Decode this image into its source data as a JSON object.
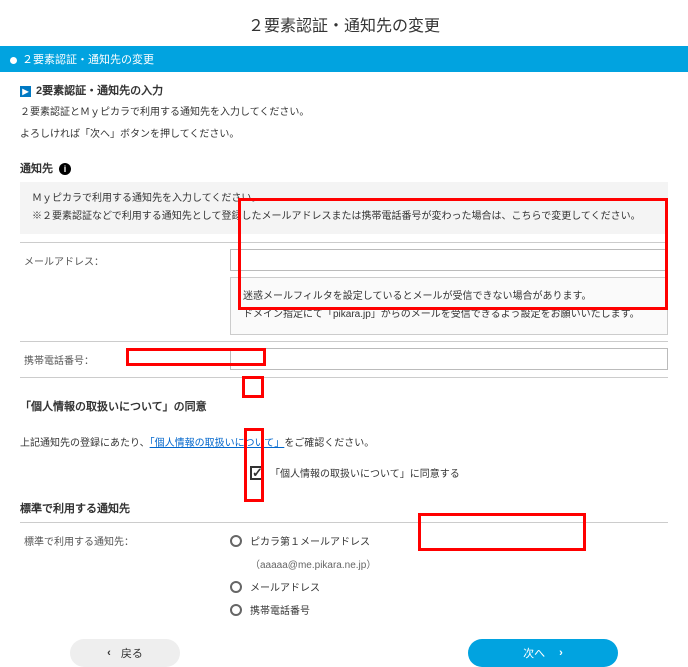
{
  "title": "２要素認証・通知先の変更",
  "blueBar": "２要素認証・通知先の変更",
  "sectionHdr": "2要素認証・通知先の入力",
  "intro1": "２要素認証とＭｙピカラで利用する通知先を入力してください。",
  "intro2": "よろしければ「次へ」ボタンを押してください。",
  "dest": {
    "label": "通知先",
    "box1": "Ｍｙピカラで利用する通知先を入力してください。",
    "box2": "※２要素認証などで利用する通知先として登録したメールアドレスまたは携帯電話番号が変わった場合は、こちらで変更してください。"
  },
  "mail": {
    "label": "メールアドレス：",
    "value": "",
    "note1": "迷惑メールフィルタを設定しているとメールが受信できない場合があります。",
    "note2": "ドメイン指定にて「pikara.jp」からのメールを受信できるよう設定をお願いいたします。"
  },
  "phone": {
    "label": "携帯電話番号：",
    "value": ""
  },
  "privacy": {
    "header": "「個人情報の取扱いについて」の同意",
    "lineBefore": "上記通知先の登録にあたり、",
    "link": "「個人情報の取扱いについて」",
    "lineAfter": "をご確認ください。",
    "consent": "「個人情報の取扱いについて」に同意する",
    "checked": true
  },
  "default": {
    "header": "標準で利用する通知先",
    "label": "標準で利用する通知先：",
    "options": [
      {
        "label": "ピカラ第１メールアドレス",
        "sub": "（aaaaa@me.pikara.ne.jp）"
      },
      {
        "label": "メールアドレス",
        "sub": ""
      },
      {
        "label": "携帯電話番号",
        "sub": ""
      }
    ]
  },
  "buttons": {
    "back": "戻る",
    "next": "次へ"
  }
}
